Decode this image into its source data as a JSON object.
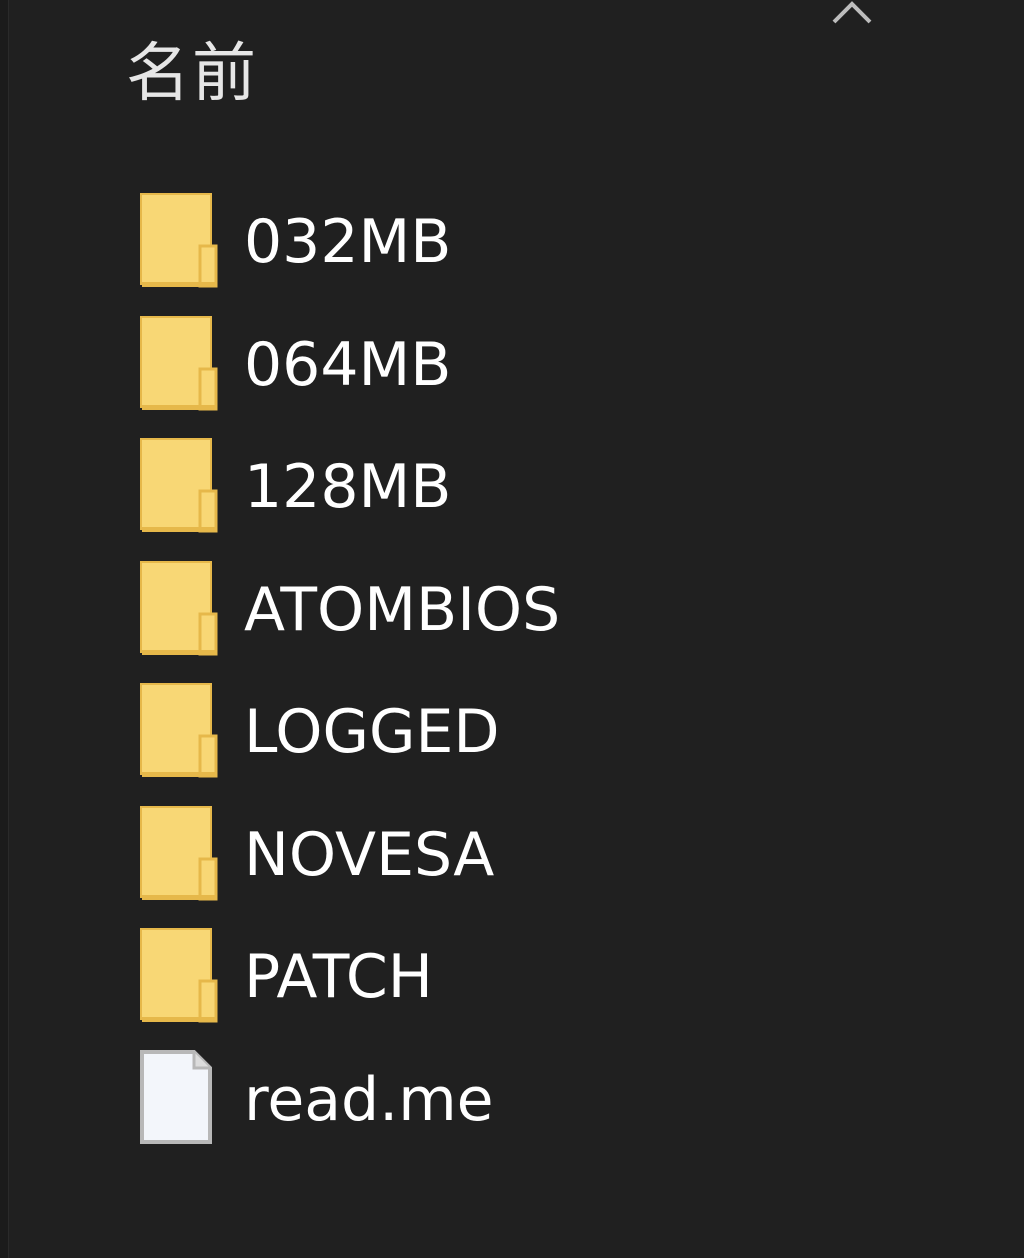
{
  "header": {
    "name_column_label": "名前",
    "sort_indicator": "chevron-up-icon"
  },
  "colors": {
    "background": "#202020",
    "folder_body": "#f8d775",
    "folder_edge": "#e6b84a",
    "file_body": "#f3f6fb",
    "file_edge": "#b8b8b8",
    "text": "#ffffff"
  },
  "items": [
    {
      "name": "032MB",
      "type": "folder",
      "icon": "folder-icon"
    },
    {
      "name": "064MB",
      "type": "folder",
      "icon": "folder-icon"
    },
    {
      "name": "128MB",
      "type": "folder",
      "icon": "folder-icon"
    },
    {
      "name": "ATOMBIOS",
      "type": "folder",
      "icon": "folder-icon"
    },
    {
      "name": "LOGGED",
      "type": "folder",
      "icon": "folder-icon"
    },
    {
      "name": "NOVESA",
      "type": "folder",
      "icon": "folder-icon"
    },
    {
      "name": "PATCH",
      "type": "folder",
      "icon": "folder-icon"
    },
    {
      "name": "read.me",
      "type": "file",
      "icon": "file-icon"
    }
  ]
}
